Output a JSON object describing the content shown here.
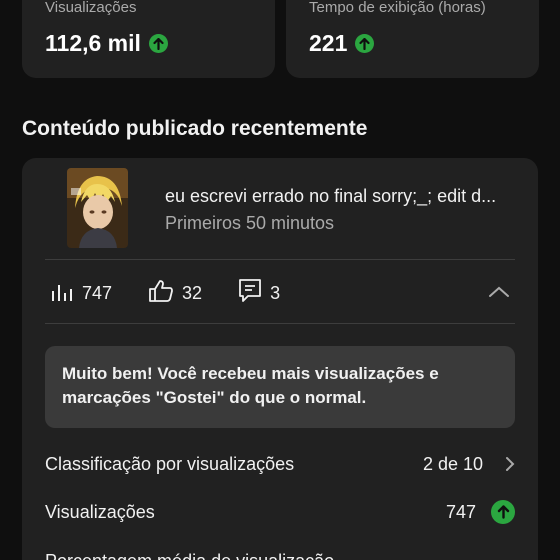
{
  "stats": [
    {
      "label": "Visualizações",
      "value": "112,6 mil",
      "trend": "up"
    },
    {
      "label": "Tempo de exibição (horas)",
      "value": "221",
      "trend": "up"
    }
  ],
  "section": {
    "title": "Conteúdo publicado recentemente"
  },
  "video": {
    "title": "eu escrevi errado no final sorry;_; edit d...",
    "subtitle": "Primeiros 50 minutos",
    "views": "747",
    "likes": "32",
    "comments": "3"
  },
  "notice": {
    "text": "Muito bem! Você recebeu mais visualizações e marcações \"Gostei\" do que o normal."
  },
  "details": [
    {
      "label": "Classificação por visualizações",
      "value": "2 de 10"
    },
    {
      "label": "Visualizações",
      "value": "747"
    },
    {
      "label": "Porcentagem média de visualização",
      "value": ""
    }
  ],
  "colors": {
    "accent_up": "#2ba640",
    "card": "#212121",
    "background": "#0f0f0f"
  },
  "icons": [
    "arrow-up-icon",
    "bar-chart-icon",
    "thumbs-up-icon",
    "comment-icon",
    "chevron-up-icon",
    "chevron-right-icon"
  ]
}
